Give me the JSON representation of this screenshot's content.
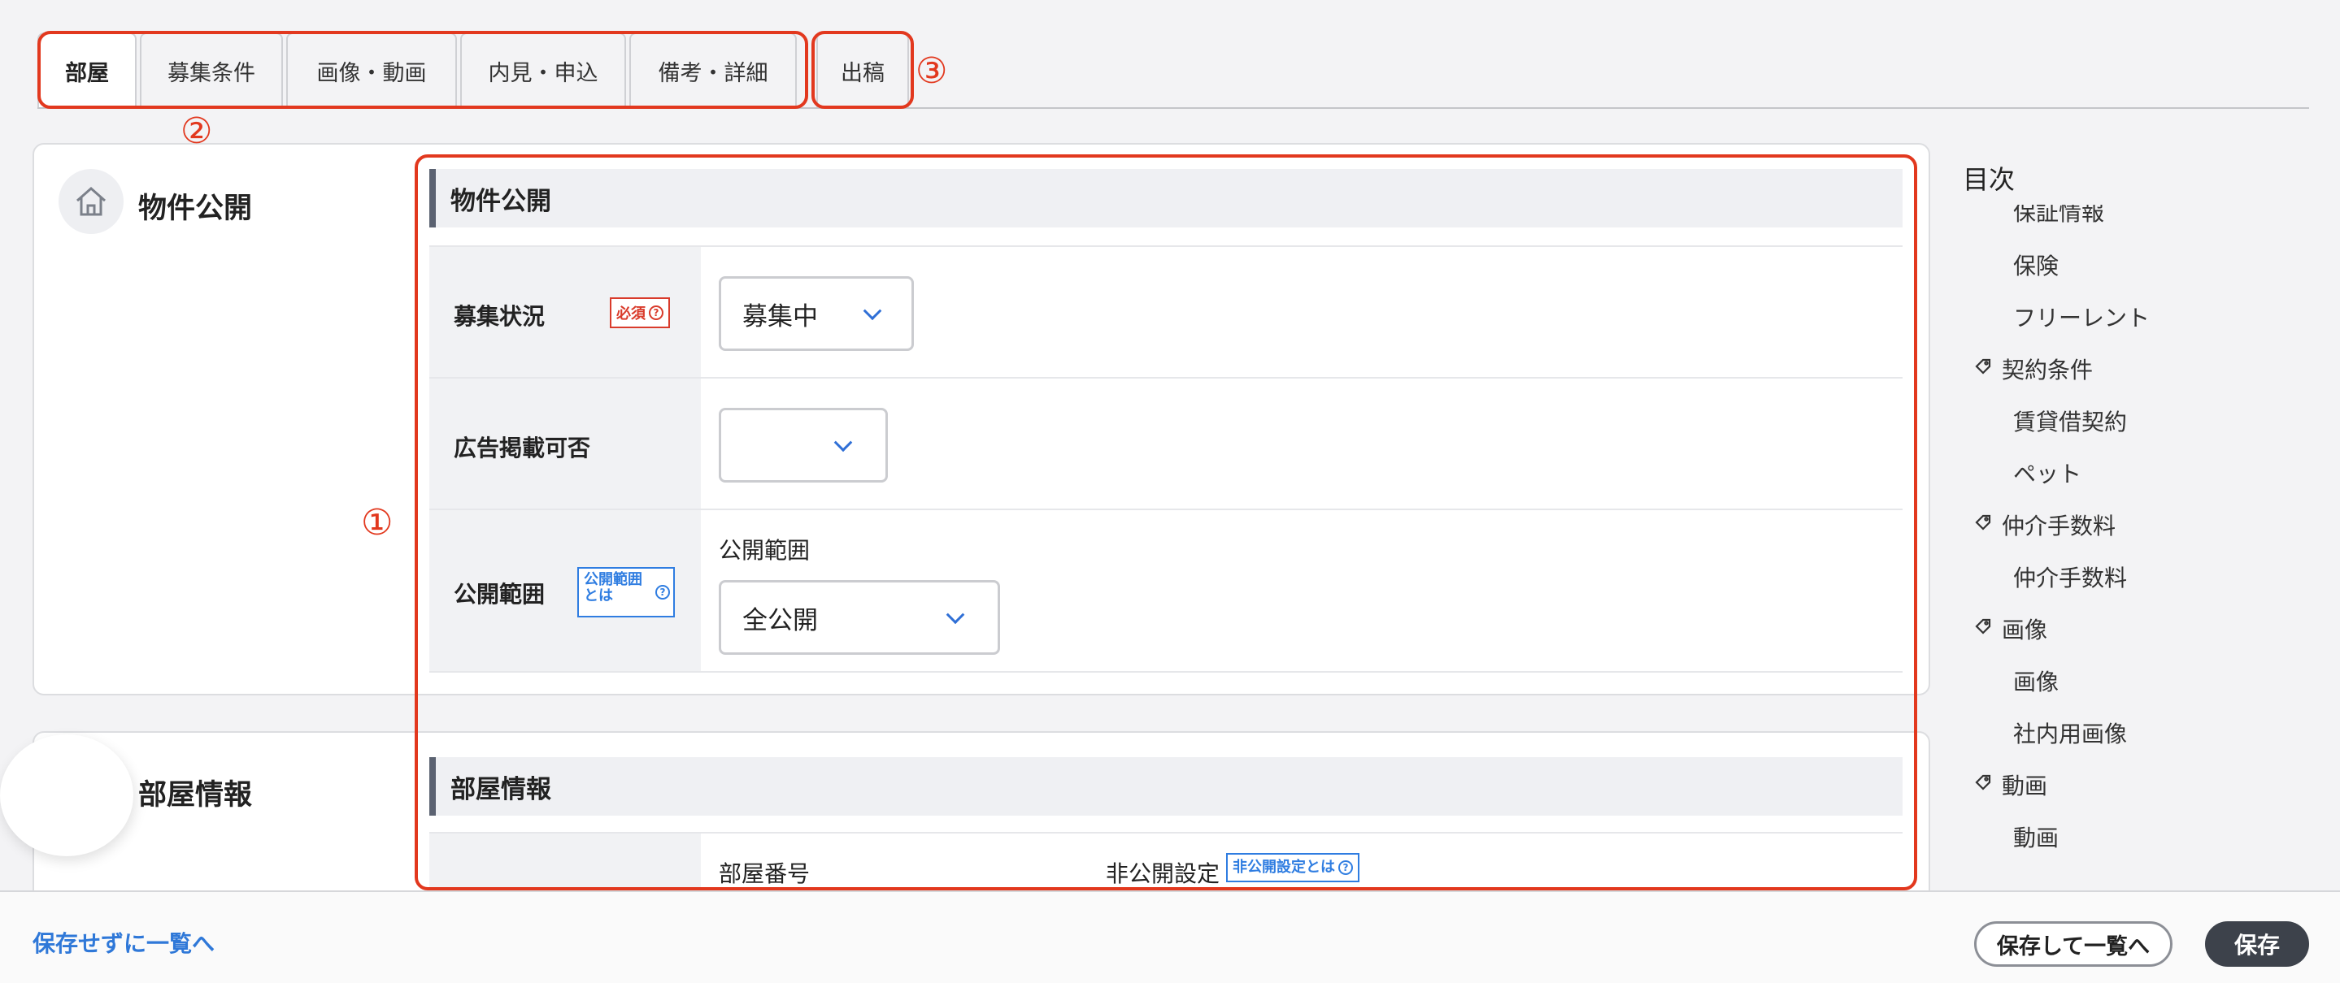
{
  "tabs": [
    {
      "label": "部屋",
      "active": true
    },
    {
      "label": "募集条件"
    },
    {
      "label": "画像・動画"
    },
    {
      "label": "内見・申込"
    },
    {
      "label": "備考・詳細"
    },
    {
      "label": "出稿"
    }
  ],
  "annotations": {
    "one": "①",
    "two": "②",
    "three": "③",
    "color": "#e2381e"
  },
  "cards": {
    "publication": {
      "title": "物件公開",
      "icon": "home-icon"
    },
    "room": {
      "title": "部屋情報"
    }
  },
  "form": {
    "section1": {
      "heading": "物件公開",
      "recruit": {
        "label": "募集状況",
        "badge": "必須",
        "value": "募集中"
      },
      "ad": {
        "label": "広告掲載可否",
        "value": ""
      },
      "scope": {
        "label": "公開範囲",
        "badge_line1": "公開範囲",
        "badge_line2": "とは",
        "field_label": "公開範囲",
        "value": "全公開"
      }
    },
    "section2": {
      "heading": "部屋情報",
      "room_number_label": "部屋番号",
      "private_label": "非公開設定",
      "private_badge": "非公開設定とは"
    }
  },
  "toc": {
    "title": "目次",
    "items": [
      {
        "label": "保証情報",
        "type": "sub"
      },
      {
        "label": "保険",
        "type": "sub"
      },
      {
        "label": "フリーレント",
        "type": "sub"
      },
      {
        "label": "契約条件",
        "type": "cat"
      },
      {
        "label": "賃貸借契約",
        "type": "sub"
      },
      {
        "label": "ペット",
        "type": "sub"
      },
      {
        "label": "仲介手数料",
        "type": "cat"
      },
      {
        "label": "仲介手数料",
        "type": "sub"
      },
      {
        "label": "画像",
        "type": "cat"
      },
      {
        "label": "画像",
        "type": "sub"
      },
      {
        "label": "社内用画像",
        "type": "sub"
      },
      {
        "label": "動画",
        "type": "cat"
      },
      {
        "label": "動画",
        "type": "sub"
      }
    ]
  },
  "footer": {
    "back_link": "保存せずに一覧へ",
    "save_and_list": "保存して一覧へ",
    "save": "保存"
  },
  "colors": {
    "accent_blue": "#2f7de1",
    "required_red": "#d93b2b",
    "annotation_red": "#e2381e",
    "dark_button": "#3d424b"
  }
}
